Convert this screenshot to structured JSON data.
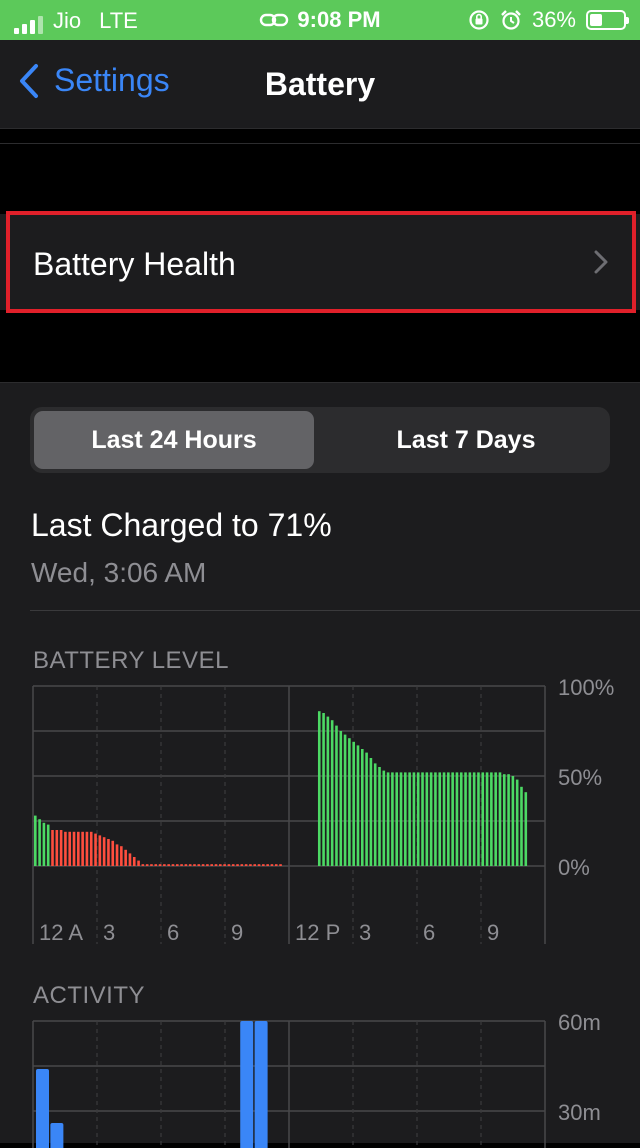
{
  "status_bar": {
    "carrier": "Jio",
    "network": "LTE",
    "time": "9:08 PM",
    "battery_percent": "36%",
    "battery_fill": 0.36,
    "icons": [
      "signal-bars-icon",
      "link-icon",
      "rotation-lock-icon",
      "alarm-icon",
      "battery-icon"
    ],
    "background": "#5cc95a"
  },
  "nav": {
    "back_label": "Settings",
    "title": "Battery"
  },
  "battery_health": {
    "label": "Battery Health"
  },
  "segmented": {
    "options": [
      "Last 24 Hours",
      "Last 7 Days"
    ],
    "selected": "Last 24 Hours"
  },
  "last_charged": {
    "title": "Last Charged to 71%",
    "subtitle": "Wed, 3:06 AM"
  },
  "battery_level": {
    "label": "BATTERY LEVEL"
  },
  "activity": {
    "label": "ACTIVITY"
  },
  "chart_data": [
    {
      "type": "bar",
      "title": "BATTERY LEVEL",
      "ylim": [
        0,
        100
      ],
      "y_ticks": [
        "100%",
        "50%",
        "0%"
      ],
      "x_ticks": [
        "12 A",
        "3",
        "6",
        "9",
        "12 P",
        "3",
        "6",
        "9"
      ],
      "grid": true,
      "colors": {
        "normal": "#4cd964",
        "low": "#ff4e3e"
      },
      "values": [
        28,
        26,
        24,
        23,
        20,
        20,
        20,
        19,
        19,
        19,
        19,
        19,
        19,
        19,
        18,
        17,
        16,
        15,
        14,
        12,
        11,
        9,
        7,
        5,
        3,
        1,
        1,
        1,
        1,
        1,
        1,
        1,
        1,
        1,
        1,
        1,
        1,
        1,
        1,
        1,
        1,
        1,
        1,
        1,
        1,
        1,
        1,
        1,
        1,
        1,
        1,
        1,
        1,
        1,
        1,
        1,
        1,
        1,
        0,
        0,
        0,
        0,
        0,
        0,
        0,
        0,
        86,
        85,
        83,
        81,
        78,
        75,
        73,
        71,
        69,
        67,
        65,
        63,
        60,
        57,
        55,
        53,
        52,
        52,
        52,
        52,
        52,
        52,
        52,
        52,
        52,
        52,
        52,
        52,
        52,
        52,
        52,
        52,
        52,
        52,
        52,
        52,
        52,
        52,
        52,
        52,
        52,
        52,
        52,
        51,
        51,
        50,
        48,
        44,
        41
      ],
      "low_flags": [
        0,
        0,
        0,
        0,
        1,
        1,
        1,
        1,
        1,
        1,
        1,
        1,
        1,
        1,
        1,
        1,
        1,
        1,
        1,
        1,
        1,
        1,
        1,
        1,
        1,
        1,
        1,
        1,
        1,
        1,
        1,
        1,
        1,
        1,
        1,
        1,
        1,
        1,
        1,
        1,
        1,
        1,
        1,
        1,
        1,
        1,
        1,
        1,
        1,
        1,
        1,
        1,
        1,
        1,
        1,
        1,
        1,
        1,
        0,
        0,
        0,
        0,
        0,
        0,
        0,
        0,
        0,
        0,
        0,
        0,
        0,
        0,
        0,
        0,
        0,
        0,
        0,
        0,
        0,
        0,
        0,
        0,
        0,
        0,
        0,
        0,
        0,
        0,
        0,
        0,
        0,
        0,
        0,
        0,
        0,
        0,
        0,
        0,
        0,
        0,
        0,
        0,
        0,
        0,
        0,
        0,
        0,
        0,
        0,
        0,
        0,
        0,
        0,
        0,
        0
      ]
    },
    {
      "type": "bar",
      "title": "ACTIVITY",
      "ylim": [
        0,
        60
      ],
      "y_ticks": [
        "60m",
        "30m"
      ],
      "grid": true,
      "color": "#3a86f7",
      "values": [
        44,
        0,
        0,
        0,
        0,
        26,
        0,
        0,
        0,
        0,
        0,
        0,
        0,
        0,
        0,
        0,
        0,
        0,
        0,
        0,
        0,
        0,
        0,
        0,
        0,
        0,
        0,
        0,
        0,
        0,
        0,
        0,
        0,
        0,
        0,
        0,
        0,
        0,
        0,
        0,
        0,
        0,
        0,
        0,
        0,
        0,
        0,
        0,
        0,
        0,
        0,
        0,
        0,
        0,
        0,
        0,
        0,
        0,
        0,
        0,
        0,
        0,
        0,
        0,
        0,
        0,
        6,
        0,
        0,
        0,
        0,
        62,
        0,
        0,
        0,
        0,
        60,
        0,
        0,
        0,
        0,
        0,
        0,
        0,
        0,
        0,
        0,
        0,
        0,
        0,
        0,
        0,
        0,
        0,
        0,
        0,
        0,
        0,
        0,
        0,
        0,
        0,
        0,
        0,
        0,
        0,
        0,
        0,
        0,
        0,
        0,
        0,
        0,
        0,
        0,
        0,
        0,
        0,
        0,
        0,
        0,
        0,
        0,
        0,
        0,
        0,
        0,
        0,
        0,
        0,
        0,
        0,
        0,
        0,
        0,
        0,
        0,
        0,
        0,
        0,
        0,
        0,
        0,
        0,
        0,
        0,
        0,
        0,
        0,
        0,
        0,
        0,
        0,
        0,
        0,
        0,
        0,
        0,
        0,
        0,
        0,
        0,
        0,
        0,
        0,
        0,
        0,
        0,
        0,
        0,
        0,
        0,
        0,
        0,
        0,
        0,
        0,
        0
      ]
    }
  ]
}
